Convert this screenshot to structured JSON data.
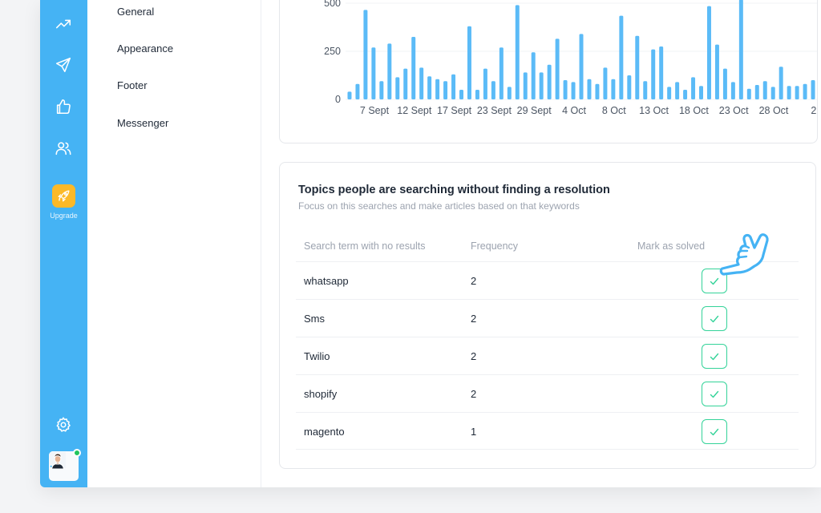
{
  "sidebar": {
    "upgrade_label": "Upgrade",
    "icons": [
      "trending-up-icon",
      "send-icon",
      "thumbs-up-icon",
      "users-icon",
      "rocket-icon",
      "settings-icon"
    ],
    "accent": "#45b3f4",
    "upgrade_color": "#fbb928"
  },
  "settings_menu": {
    "items": [
      {
        "label": "General"
      },
      {
        "label": "Appearance"
      },
      {
        "label": "Footer"
      },
      {
        "label": "Messenger"
      }
    ]
  },
  "chart_data": {
    "type": "bar",
    "y_ticks": [
      "0",
      "250",
      "500"
    ],
    "ylim": [
      0,
      500
    ],
    "x_ticks": [
      "7 Sept",
      "12 Sept",
      "17 Sept",
      "23 Sept",
      "29 Sept",
      "4 Oct",
      "8 Oct",
      "13 Oct",
      "18 Oct",
      "23 Oct",
      "28 Oct",
      "2"
    ],
    "values": [
      40,
      80,
      465,
      270,
      95,
      290,
      115,
      160,
      325,
      165,
      120,
      105,
      95,
      130,
      50,
      380,
      50,
      160,
      95,
      270,
      65,
      490,
      140,
      245,
      140,
      180,
      315,
      100,
      90,
      340,
      105,
      80,
      165,
      105,
      435,
      125,
      330,
      95,
      260,
      275,
      65,
      90,
      50,
      115,
      70,
      485,
      285,
      160,
      90,
      520,
      55,
      75,
      95,
      65,
      170,
      70,
      70,
      80,
      100,
      45
    ],
    "color": "#5bbbf7"
  },
  "topics": {
    "title": "Topics people are searching without finding a resolution",
    "subtitle": "Focus on this searches and make articles based on that keywords",
    "columns": [
      "Search term with no results",
      "Frequency",
      "Mark as solved"
    ],
    "rows": [
      {
        "term": "whatsapp",
        "frequency": "2"
      },
      {
        "term": "Sms",
        "frequency": "2"
      },
      {
        "term": "Twilio",
        "frequency": "2"
      },
      {
        "term": "shopify",
        "frequency": "2"
      },
      {
        "term": "magento",
        "frequency": "1"
      }
    ],
    "check_color": "#34d399"
  }
}
